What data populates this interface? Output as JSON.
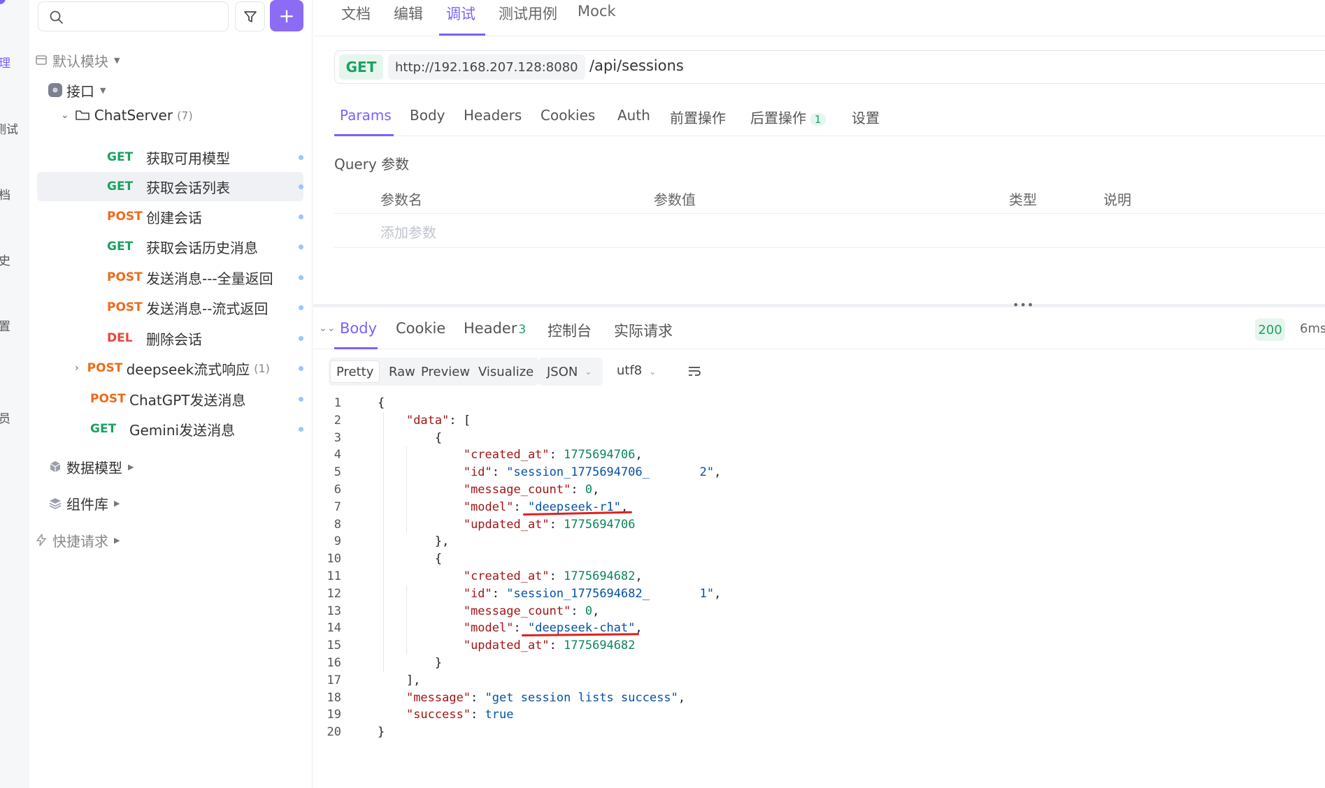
{
  "leftnav": {
    "items": [
      "理",
      "测试",
      "档",
      "史",
      "置",
      "员"
    ]
  },
  "sidebar": {
    "search_placeholder": "",
    "add_label": "+",
    "default_module": "默认模块",
    "interfaces": "接口",
    "folder_name": "ChatServer",
    "folder_count": "(7)",
    "items": [
      {
        "method": "GET",
        "name": "获取可用模型"
      },
      {
        "method": "GET",
        "name": "获取会话列表"
      },
      {
        "method": "POST",
        "name": "创建会话"
      },
      {
        "method": "GET",
        "name": "获取会话历史消息"
      },
      {
        "method": "POST",
        "name": "发送消息---全量返回"
      },
      {
        "method": "POST",
        "name": "发送消息--流式返回"
      },
      {
        "method": "DEL",
        "name": "删除会话"
      }
    ],
    "deepseek": {
      "method": "POST",
      "name": "deepseek流式响应",
      "count": "(1)"
    },
    "chatgpt": {
      "method": "POST",
      "name": "ChatGPT发送消息"
    },
    "gemini": {
      "method": "GET",
      "name": "Gemini发送消息"
    },
    "data_models": "数据模型",
    "components": "组件库",
    "quick_requests": "快捷请求"
  },
  "toptabs": [
    "文档",
    "编辑",
    "调试",
    "测试用例",
    "Mock"
  ],
  "request": {
    "method": "GET",
    "host": "http://192.168.207.128:8080",
    "path": "/api/sessions"
  },
  "reqtabs": [
    "Params",
    "Body",
    "Headers",
    "Cookies",
    "Auth",
    "前置操作",
    "后置操作",
    "设置"
  ],
  "post_ops_count": "1",
  "query": {
    "title": "Query 参数",
    "columns": [
      "参数名",
      "参数值",
      "类型",
      "说明"
    ],
    "add_placeholder": "添加参数"
  },
  "response": {
    "tabs": [
      "Body",
      "Cookie",
      "Header",
      "控制台",
      "实际请求"
    ],
    "header_count": "3",
    "status": "200",
    "time": "6ms",
    "views": [
      "Pretty",
      "Raw",
      "Preview",
      "Visualize"
    ],
    "format": "JSON",
    "encoding": "utf8"
  },
  "code_lines": [
    [
      {
        "t": "p",
        "v": "{"
      }
    ],
    [
      {
        "t": "p",
        "v": "    "
      },
      {
        "t": "k",
        "v": "\"data\""
      },
      {
        "t": "p",
        "v": ": ["
      }
    ],
    [
      {
        "t": "p",
        "v": "        {"
      }
    ],
    [
      {
        "t": "p",
        "v": "            "
      },
      {
        "t": "k",
        "v": "\"created_at\""
      },
      {
        "t": "p",
        "v": ": "
      },
      {
        "t": "n",
        "v": "1775694706"
      },
      {
        "t": "p",
        "v": ","
      }
    ],
    [
      {
        "t": "p",
        "v": "            "
      },
      {
        "t": "k",
        "v": "\"id\""
      },
      {
        "t": "p",
        "v": ": "
      },
      {
        "t": "s",
        "v": "\"session_1775694706_       2\""
      },
      {
        "t": "p",
        "v": ","
      }
    ],
    [
      {
        "t": "p",
        "v": "            "
      },
      {
        "t": "k",
        "v": "\"message_count\""
      },
      {
        "t": "p",
        "v": ": "
      },
      {
        "t": "n",
        "v": "0"
      },
      {
        "t": "p",
        "v": ","
      }
    ],
    [
      {
        "t": "p",
        "v": "            "
      },
      {
        "t": "k",
        "v": "\"model\""
      },
      {
        "t": "p",
        "v": ": "
      },
      {
        "t": "s",
        "v": "\"deepseek-r1\""
      },
      {
        "t": "p",
        "v": ","
      }
    ],
    [
      {
        "t": "p",
        "v": "            "
      },
      {
        "t": "k",
        "v": "\"updated_at\""
      },
      {
        "t": "p",
        "v": ": "
      },
      {
        "t": "n",
        "v": "1775694706"
      }
    ],
    [
      {
        "t": "p",
        "v": "        },"
      }
    ],
    [
      {
        "t": "p",
        "v": "        {"
      }
    ],
    [
      {
        "t": "p",
        "v": "            "
      },
      {
        "t": "k",
        "v": "\"created_at\""
      },
      {
        "t": "p",
        "v": ": "
      },
      {
        "t": "n",
        "v": "1775694682"
      },
      {
        "t": "p",
        "v": ","
      }
    ],
    [
      {
        "t": "p",
        "v": "            "
      },
      {
        "t": "k",
        "v": "\"id\""
      },
      {
        "t": "p",
        "v": ": "
      },
      {
        "t": "s",
        "v": "\"session_1775694682_       1\""
      },
      {
        "t": "p",
        "v": ","
      }
    ],
    [
      {
        "t": "p",
        "v": "            "
      },
      {
        "t": "k",
        "v": "\"message_count\""
      },
      {
        "t": "p",
        "v": ": "
      },
      {
        "t": "n",
        "v": "0"
      },
      {
        "t": "p",
        "v": ","
      }
    ],
    [
      {
        "t": "p",
        "v": "            "
      },
      {
        "t": "k",
        "v": "\"model\""
      },
      {
        "t": "p",
        "v": ": "
      },
      {
        "t": "s",
        "v": "\"deepseek-chat\""
      },
      {
        "t": "p",
        "v": ","
      }
    ],
    [
      {
        "t": "p",
        "v": "            "
      },
      {
        "t": "k",
        "v": "\"updated_at\""
      },
      {
        "t": "p",
        "v": ": "
      },
      {
        "t": "n",
        "v": "1775694682"
      }
    ],
    [
      {
        "t": "p",
        "v": "        }"
      }
    ],
    [
      {
        "t": "p",
        "v": "    ],"
      }
    ],
    [
      {
        "t": "p",
        "v": "    "
      },
      {
        "t": "k",
        "v": "\"message\""
      },
      {
        "t": "p",
        "v": ": "
      },
      {
        "t": "s",
        "v": "\"get session lists success\""
      },
      {
        "t": "p",
        "v": ","
      }
    ],
    [
      {
        "t": "p",
        "v": "    "
      },
      {
        "t": "k",
        "v": "\"success\""
      },
      {
        "t": "p",
        "v": ": "
      },
      {
        "t": "b",
        "v": "true"
      }
    ],
    [
      {
        "t": "p",
        "v": "}"
      }
    ]
  ],
  "colors": {
    "accent": "#7b61ff",
    "get": "#1aa261",
    "post": "#ee6b1b",
    "del": "#e5483b",
    "annotation": "#e02020"
  }
}
